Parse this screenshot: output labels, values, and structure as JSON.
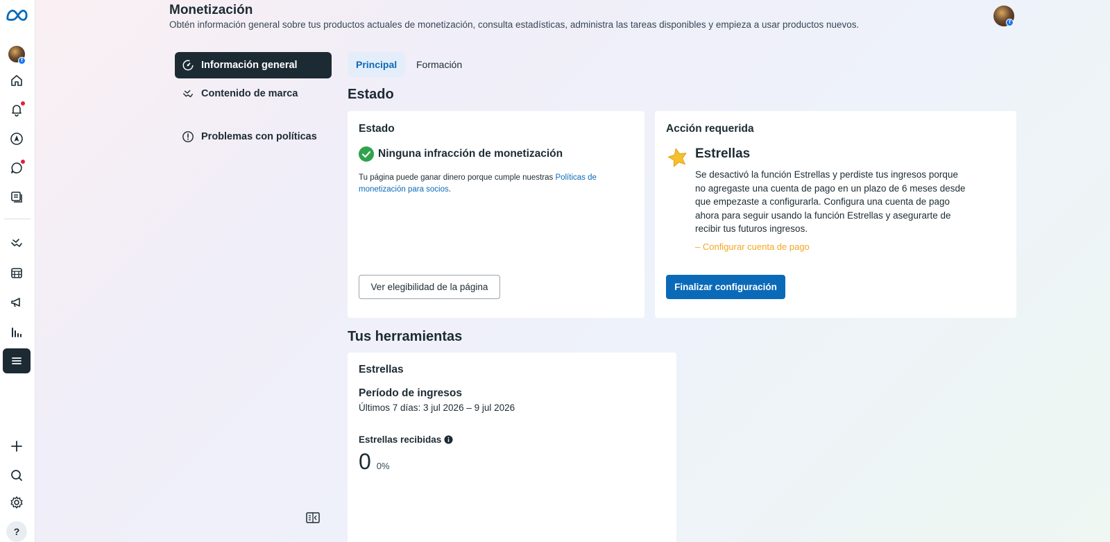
{
  "header": {
    "title": "Monetización",
    "subtitle": "Obtén información general sobre tus productos actuales de monetización, consulta estadísticas, administra las tareas disponibles y empieza a usar productos nuevos."
  },
  "rail": {
    "items": [
      "meta-logo",
      "profile",
      "home",
      "notifications",
      "navigator",
      "messages",
      "pages",
      "branded-content",
      "calendar",
      "ads",
      "insights",
      "all-tools",
      "create",
      "search",
      "settings",
      "help"
    ],
    "help_label": "?"
  },
  "nav": {
    "items": [
      {
        "label": "Información general",
        "icon": "gauge-icon",
        "active": true
      },
      {
        "label": "Contenido de marca",
        "icon": "handshake-icon",
        "active": false
      },
      {
        "label": "Problemas con políticas",
        "icon": "alert-icon",
        "active": false
      }
    ]
  },
  "tabs": [
    {
      "label": "Principal",
      "active": true
    },
    {
      "label": "Formación",
      "active": false
    }
  ],
  "status_section": {
    "title": "Estado",
    "status_card": {
      "title": "Estado",
      "headline": "Ninguna infracción de monetización",
      "body_prefix": "Tu página puede ganar dinero porque cumple nuestras ",
      "body_link": "Políticas de monetización para socios",
      "body_suffix": ".",
      "button_label": "Ver elegibilidad de la página"
    },
    "action_card": {
      "title": "Acción requerida",
      "product": "Estrellas",
      "body": "Se desactivó la función Estrellas y perdiste tus ingresos porque no agregaste una cuenta de pago en un plazo de 6 meses desde que empezaste a configurarla. Configura una cuenta de pago ahora para seguir usando la función Estrellas y asegurarte de recibir tus futuros ingresos.",
      "task": "– Configurar cuenta de pago",
      "button_label": "Finalizar configuración"
    }
  },
  "tools_section": {
    "title": "Tus herramientas",
    "stars_card": {
      "title": "Estrellas",
      "period_title": "Período de ingresos",
      "period_range": "Últimos 7 días: 3 jul 2026 – 9 jul 2026",
      "metric_label": "Estrellas recibidas",
      "metric_value": "0",
      "metric_change": "0%"
    }
  },
  "colors": {
    "accent": "#0a6ab8",
    "success": "#31a24c",
    "warning": "#f5a623",
    "dark": "#1c2b33",
    "notification": "#e41e3f"
  }
}
